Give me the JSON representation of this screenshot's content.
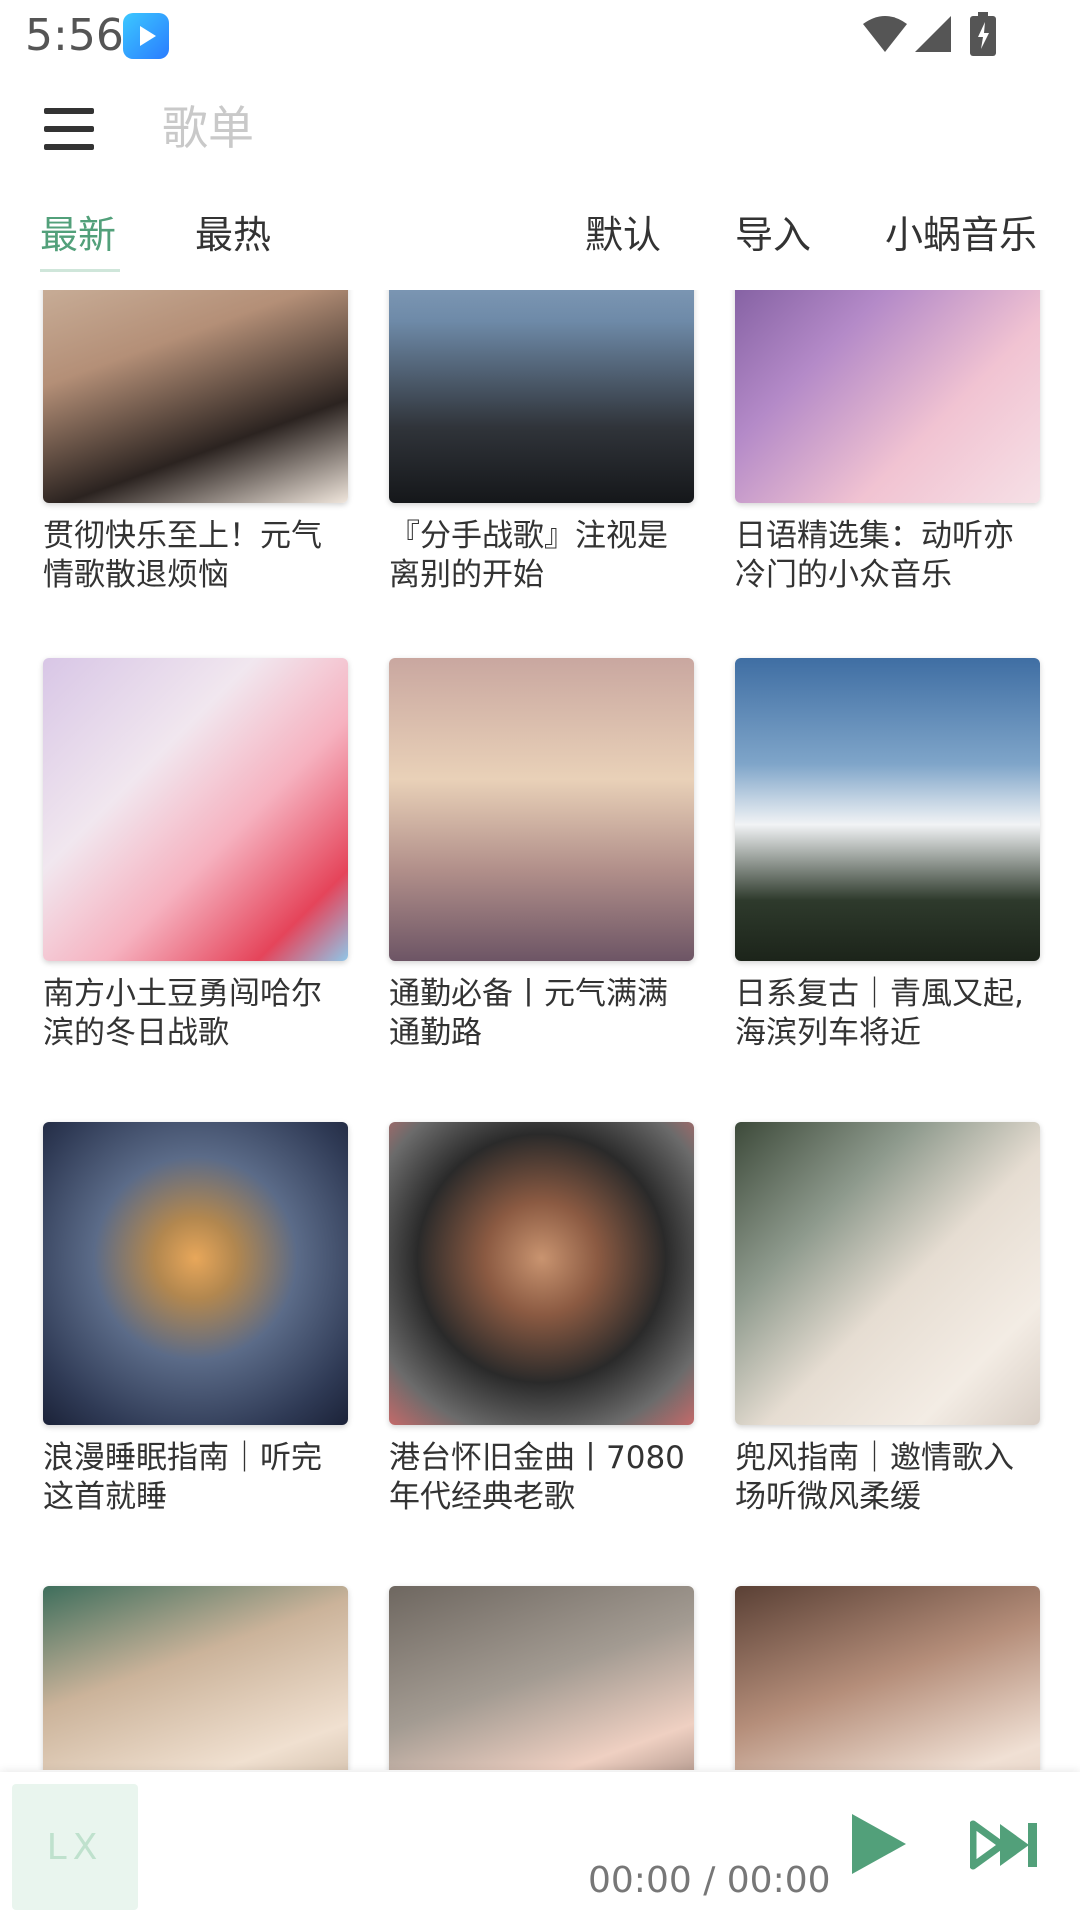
{
  "status_bar": {
    "time": "5:56"
  },
  "header": {
    "title": "歌单"
  },
  "tabs": [
    {
      "label": "最新"
    },
    {
      "label": "最热"
    },
    {
      "label": "默认"
    },
    {
      "label": "导入"
    },
    {
      "label": "小蜗音乐"
    }
  ],
  "playlists": [
    {
      "title": "贯彻快乐至上！元气情歌散退烦恼"
    },
    {
      "title": "『分手战歌』注视是离别的开始"
    },
    {
      "title": "日语精选集：动听亦冷门的小众音乐"
    },
    {
      "title": "南方小土豆勇闯哈尔滨的冬日战歌"
    },
    {
      "title": "通勤必备丨元气满满通勤路"
    },
    {
      "title": "日系复古｜青風又起,海滨列车将近"
    },
    {
      "title": "浪漫睡眠指南｜听完这首就睡"
    },
    {
      "title": "港台怀旧金曲丨7080年代经典老歌"
    },
    {
      "title": "兜风指南｜邀情歌入场听微风柔缓"
    },
    {
      "title": ""
    },
    {
      "title": ""
    },
    {
      "title": ""
    }
  ],
  "player": {
    "logo_text": "LX",
    "time": "00:00 / 00:00"
  },
  "colors": {
    "accent": "#52a07a",
    "tab_underline": "#cfe6da"
  },
  "icons": [
    "menu-icon",
    "wifi-icon",
    "signal-icon",
    "battery-icon",
    "play-icon",
    "skip-next-icon"
  ]
}
